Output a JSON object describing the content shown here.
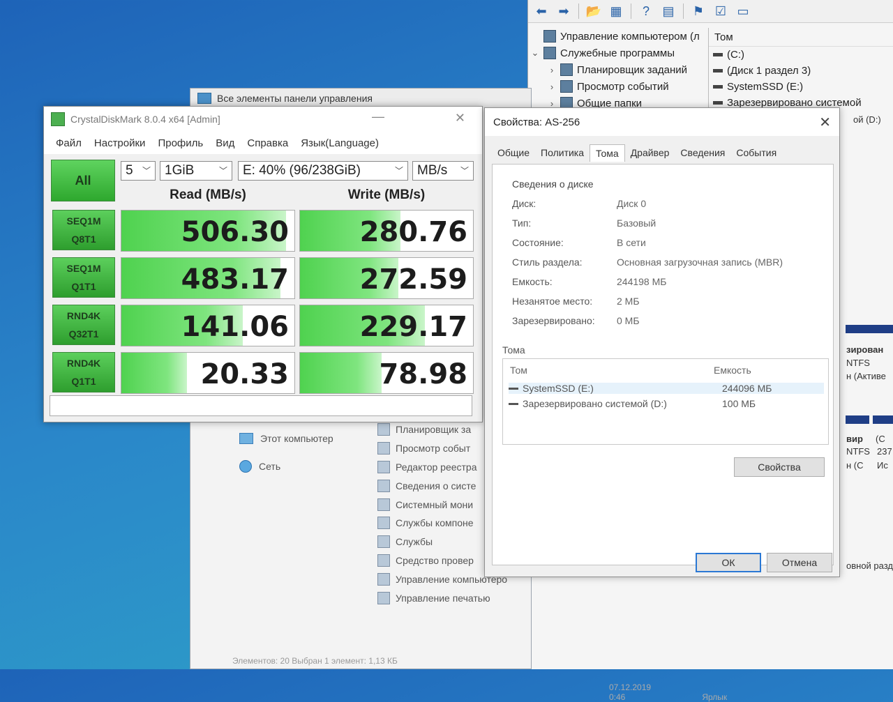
{
  "control_panel": {
    "title": "Все элементы панели управления",
    "sidebar": [
      "Этот компьютер",
      "Сеть"
    ],
    "tools": [
      "Планировщик за",
      "Просмотр событ",
      "Редактор реестра",
      "Сведения о систе",
      "Системный мони",
      "Службы компоне",
      "Службы",
      "Средство провер",
      "Управление компьютеро",
      "Управление печатью"
    ],
    "date": "07.12.2019 0:46",
    "type_label": "Ярлык",
    "footer": "Элементов: 20   Выбран 1 элемент: 1,13 КБ"
  },
  "computer_management": {
    "tree": [
      {
        "label": "Управление компьютером (л",
        "chevron": ""
      },
      {
        "label": "Служебные программы",
        "chevron": "⌄"
      },
      {
        "label": "Планировщик заданий",
        "chevron": "›"
      },
      {
        "label": "Просмотр событий",
        "chevron": "›"
      },
      {
        "label": "Общие папки",
        "chevron": "›"
      }
    ],
    "volumes_header": "Том",
    "volumes": [
      "(C:)",
      "(Диск 1 раздел 3)",
      "SystemSSD (E:)",
      "Зарезервировано системой"
    ],
    "right_text": [
      "ой (D:)",
      "зирован",
      "NTFS",
      "н (Активе",
      "вир",
      "NTFS",
      "н (С",
      "(С",
      "237",
      "Ис",
      "овной разд"
    ]
  },
  "cdm": {
    "title": "CrystalDiskMark 8.0.4 x64 [Admin]",
    "menu": [
      "Файл",
      "Настройки",
      "Профиль",
      "Вид",
      "Справка",
      "Язык(Language)"
    ],
    "all_label": "All",
    "count": "5",
    "size": "1GiB",
    "drive": "E: 40% (96/238GiB)",
    "unit": "MB/s",
    "read_header": "Read (MB/s)",
    "write_header": "Write (MB/s)",
    "tests": [
      {
        "line1": "SEQ1M",
        "line2": "Q8T1",
        "read": "506.30",
        "write": "280.76",
        "read_pct": 0.95,
        "write_pct": 0.58
      },
      {
        "line1": "SEQ1M",
        "line2": "Q1T1",
        "read": "483.17",
        "write": "272.59",
        "read_pct": 0.92,
        "write_pct": 0.57
      },
      {
        "line1": "RND4K",
        "line2": "Q32T1",
        "read": "141.06",
        "write": "229.17",
        "read_pct": 0.7,
        "write_pct": 0.72
      },
      {
        "line1": "RND4K",
        "line2": "Q1T1",
        "read": "20.33",
        "write": "78.98",
        "read_pct": 0.38,
        "write_pct": 0.47
      }
    ]
  },
  "properties": {
    "title": "Свойства: AS-256",
    "tabs": [
      "Общие",
      "Политика",
      "Тома",
      "Драйвер",
      "Сведения",
      "События"
    ],
    "active_tab": "Тома",
    "section": "Сведения о диске",
    "fields": [
      {
        "label": "Диск:",
        "value": "Диск 0"
      },
      {
        "label": "Тип:",
        "value": "Базовый"
      },
      {
        "label": "Состояние:",
        "value": "В сети"
      },
      {
        "label": "Стиль раздела:",
        "value": "Основная загрузочная запись (MBR)"
      },
      {
        "label": "Емкость:",
        "value": "244198 МБ"
      },
      {
        "label": "Незанятое место:",
        "value": "2 МБ"
      },
      {
        "label": "Зарезервировано:",
        "value": "0 МБ"
      }
    ],
    "volumes_group": "Тома",
    "col_volume": "Том",
    "col_capacity": "Емкость",
    "volumes": [
      {
        "name": "SystemSSD (E:)",
        "capacity": "244096 МБ"
      },
      {
        "name": "Зарезервировано системой (D:)",
        "capacity": "100 МБ"
      }
    ],
    "properties_button": "Свойства",
    "ok_button": "ОК",
    "cancel_button": "Отмена"
  }
}
